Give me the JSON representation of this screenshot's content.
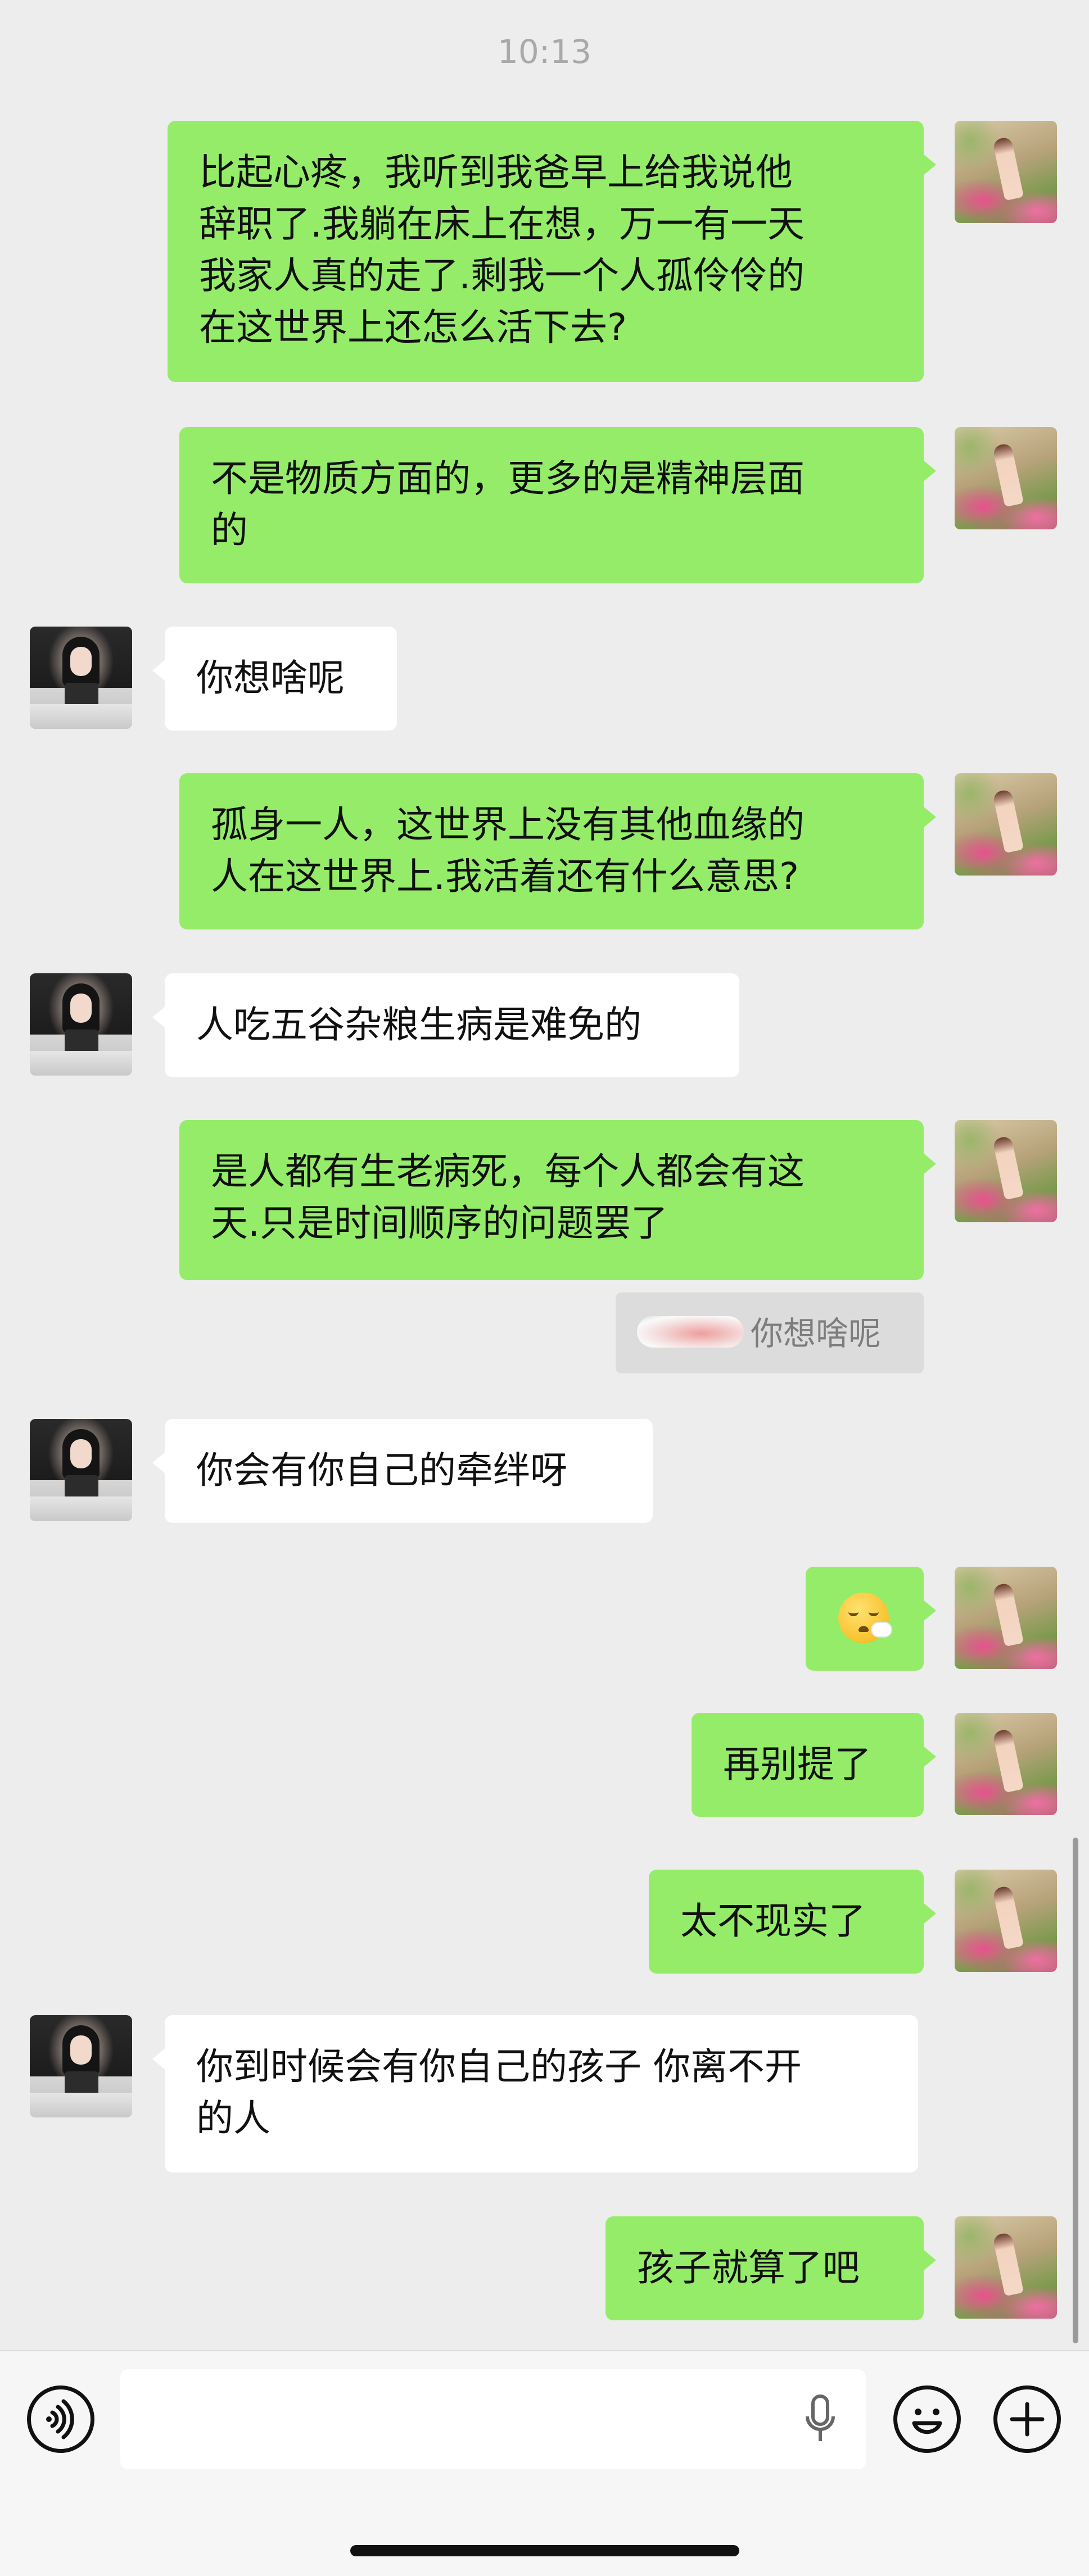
{
  "status_time": "10:13",
  "messages": [
    {
      "sender": "me",
      "text": "比起心疼，我听到我爸早上给我说他\n辞职了.我躺在床上在想，万一有一天\n我家人真的走了.剩我一个人孤伶伶的\n在这世界上还怎么活下去?"
    },
    {
      "sender": "me",
      "text": "不是物质方面的，更多的是精神层面\n的"
    },
    {
      "sender": "other",
      "text": "你想啥呢"
    },
    {
      "sender": "me",
      "text": "孤身一人，这世界上没有其他血缘的\n人在这世界上.我活着还有什么意思?"
    },
    {
      "sender": "other",
      "text": "人吃五谷杂粮生病是难免的"
    },
    {
      "sender": "me",
      "text": "是人都有生老病死，每个人都会有这\n天.只是时间顺序的问题罢了",
      "quote": "你想啥呢"
    },
    {
      "sender": "other",
      "text": "你会有你自己的牵绊呀"
    },
    {
      "sender": "me",
      "emoji": "face-exhaling-icon"
    },
    {
      "sender": "me",
      "text": "再别提了"
    },
    {
      "sender": "me",
      "text": "太不现实了"
    },
    {
      "sender": "other",
      "text": "你到时候会有你自己的孩子 你离不开\n的人"
    },
    {
      "sender": "me",
      "text": "孩子就算了吧"
    }
  ],
  "input_bar": {
    "voice_icon": "voice-icon",
    "mic_icon": "microphone-icon",
    "emoji_icon": "smiley-icon",
    "add_icon": "plus-icon"
  }
}
